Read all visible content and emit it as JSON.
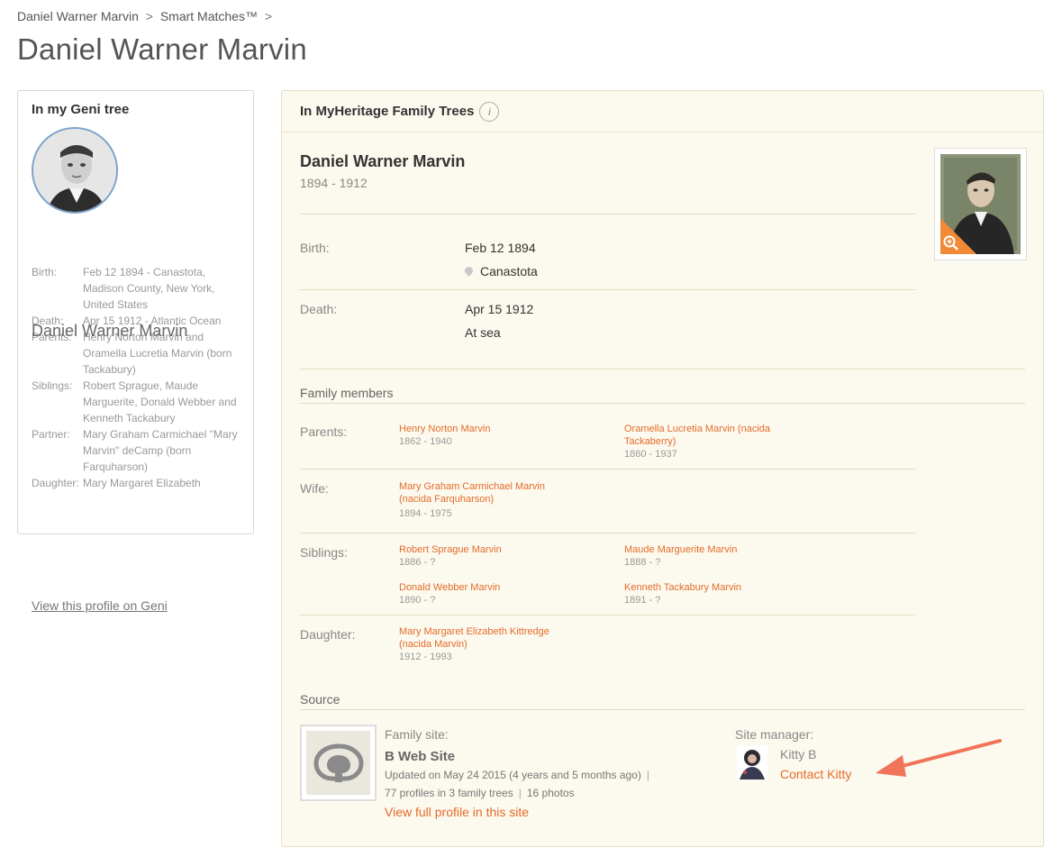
{
  "breadcrumb": {
    "item1": "Daniel Warner Marvin",
    "item2": "Smart Matches™",
    "sep": ">"
  },
  "page_title": "Daniel Warner Marvin",
  "geni": {
    "heading": "In my Geni tree",
    "name": "Daniel Warner Marvin",
    "facts": [
      {
        "label": "Birth:",
        "value": "Feb 12 1894 - Canastota, Madison County, New York, United States"
      },
      {
        "label": "Death:",
        "value": "Apr 15 1912 - Atlantic Ocean"
      },
      {
        "label": "Parents:",
        "value": "Henry Norton Marvin and Oramella Lucretia Marvin (born Tackabury)"
      },
      {
        "label": "Siblings:",
        "value": "Robert Sprague, Maude Marguerite, Donald Webber and Kenneth Tackabury"
      },
      {
        "label": "Partner:",
        "value": "Mary Graham Carmichael \"Mary Marvin\" deCamp (born Farquharson)"
      },
      {
        "label": "Daughter:",
        "value": "Mary Margaret Elizabeth"
      }
    ],
    "link": "View this profile on Geni"
  },
  "myheritage": {
    "heading": "In MyHeritage Family Trees",
    "info_icon": "i",
    "name": "Daniel Warner Marvin",
    "dates": "1894 - 1912",
    "birth_label": "Birth:",
    "birth_date": "Feb 12 1894",
    "birth_place": "Canastota",
    "death_label": "Death:",
    "death_date": "Apr 15 1912",
    "death_place": "At sea",
    "family_title": "Family members",
    "parents_label": "Parents:",
    "parents": [
      {
        "name": "Henry Norton Marvin",
        "dates": "1862 - 1940"
      },
      {
        "name": "Oramella Lucretia Marvin (nacida Tackaberry)",
        "dates": "1860 - 1937"
      }
    ],
    "wife_label": "Wife:",
    "wife": {
      "name": "Mary Graham Carmichael Marvin (nacida Farquharson)",
      "dates": "1894 - 1975"
    },
    "siblings_label": "Siblings:",
    "siblings": [
      {
        "name": "Robert Sprague Marvin",
        "dates": "1886 - ?"
      },
      {
        "name": "Maude Marguerite Marvin",
        "dates": "1888 - ?"
      },
      {
        "name": "Donald Webber Marvin",
        "dates": "1890 - ?"
      },
      {
        "name": "Kenneth Tackabury Marvin",
        "dates": "1891 - ?"
      }
    ],
    "daughter_label": "Daughter:",
    "daughter": {
      "name": "Mary Margaret Elizabeth Kittredge (nacida Marvin)",
      "dates": "1912 - 1993"
    },
    "source_title": "Source",
    "family_site_label": "Family site:",
    "site_name": "B Web Site",
    "updated": "Updated on May 24 2015 (4 years and 5 months ago)",
    "profiles": "77 profiles in 3 family trees",
    "photos": "16 photos",
    "view_full": "View full profile in this site",
    "site_manager_label": "Site manager:",
    "manager_name": "Kitty B",
    "contact": "Contact Kitty"
  },
  "colors": {
    "accent": "#e36c2a",
    "panel_bg": "#fcf9ee",
    "arrow": "#f0735a"
  }
}
